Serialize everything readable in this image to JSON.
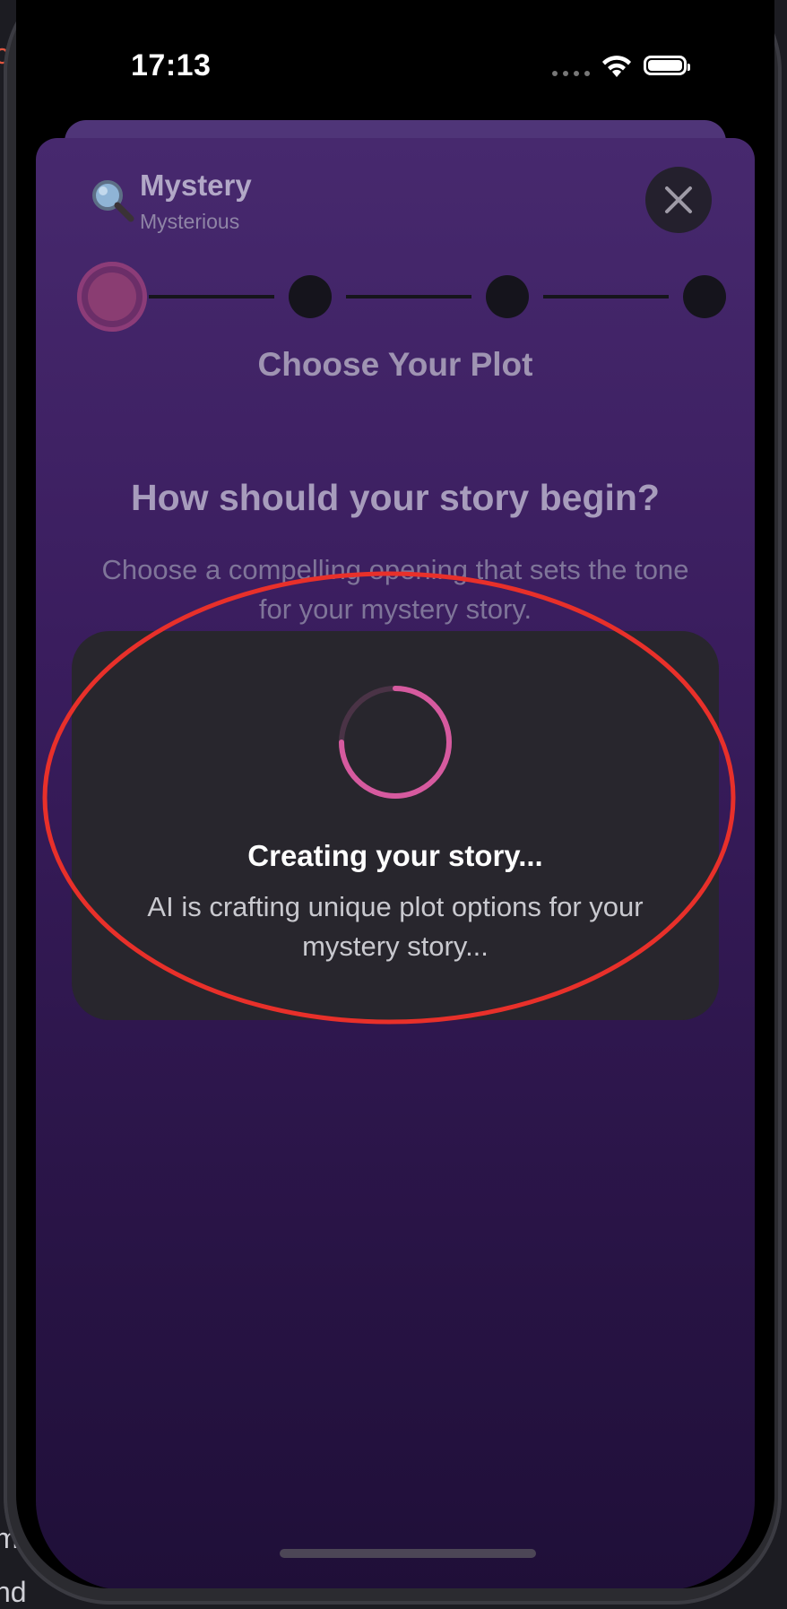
{
  "status_bar": {
    "time": "17:13"
  },
  "header": {
    "title": "Mystery",
    "subtitle": "Mysterious",
    "icon": "magnifying-glass-icon"
  },
  "progress": {
    "current_step": 1,
    "total_steps": 4
  },
  "step_title": "Choose Your Plot",
  "question": "How should your story begin?",
  "description": "Choose a compelling opening that sets the tone for your mystery story.",
  "loading": {
    "title": "Creating your story...",
    "message": "AI is crafting unique plot options for your mystery story..."
  },
  "background_fragments": [
    "ce",
    "m",
    "nd"
  ],
  "colors": {
    "accent": "#d65a9f",
    "sheet_top": "#47296e",
    "sheet_bottom": "#1f0f38",
    "annotation": "#e8302a"
  }
}
